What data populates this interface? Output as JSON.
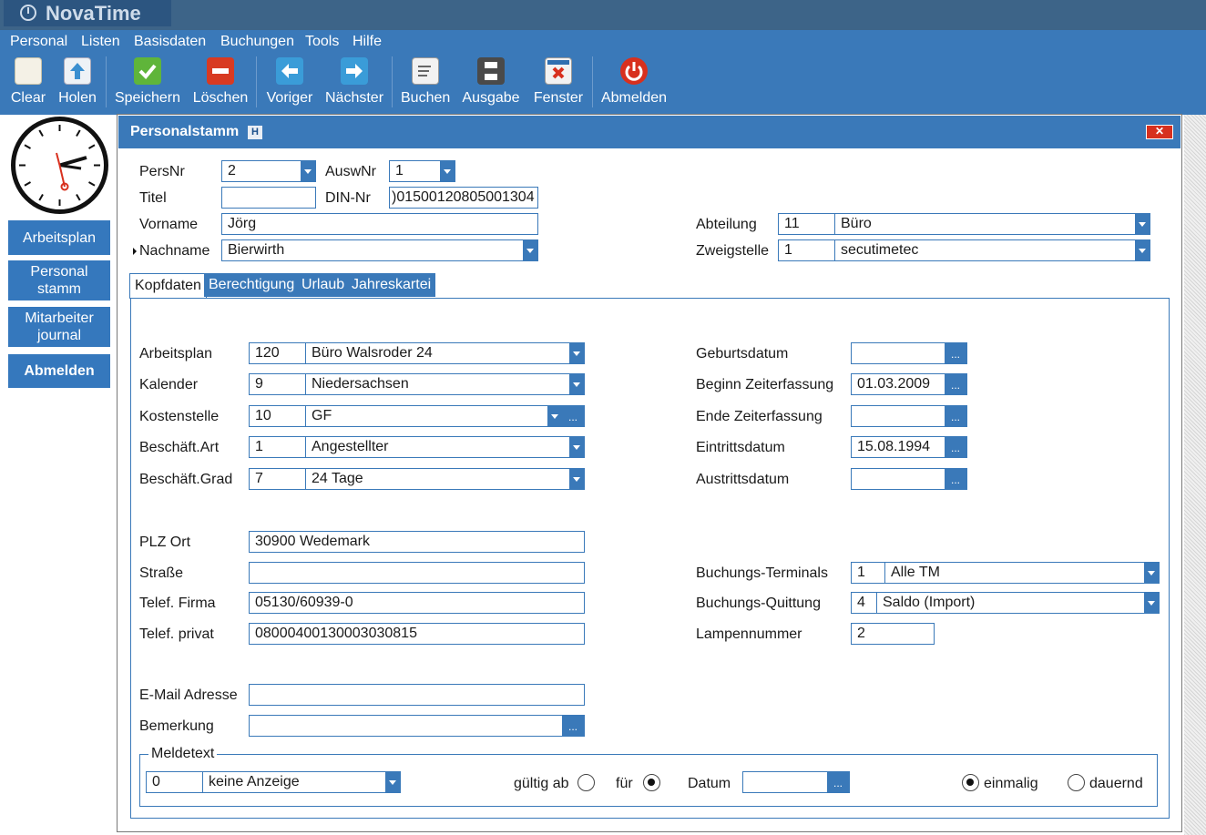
{
  "app": {
    "title": "NovaTime"
  },
  "menu": [
    "Personal",
    "Listen",
    "Basisdaten",
    "Buchungen",
    "Tools",
    "Hilfe"
  ],
  "toolbar": [
    {
      "label": "Clear",
      "icon": "document-icon"
    },
    {
      "label": "Holen",
      "icon": "upload-icon"
    },
    {
      "label": "Speichern",
      "icon": "checkmark-icon"
    },
    {
      "label": "Löschen",
      "icon": "minus-icon"
    },
    {
      "label": "Voriger",
      "icon": "arrow-left-icon"
    },
    {
      "label": "Nächster",
      "icon": "arrow-right-icon"
    },
    {
      "label": "Buchen",
      "icon": "edit-icon"
    },
    {
      "label": "Ausgabe",
      "icon": "printer-icon"
    },
    {
      "label": "Fenster",
      "icon": "close-window-icon"
    },
    {
      "label": "Abmelden",
      "icon": "power-icon"
    }
  ],
  "sidebar": {
    "arbeitsplan": "Arbeitsplan",
    "personalstamm": "Personal stamm",
    "mitarbeiterjournal": "Mitarbeiter journal",
    "abmelden": "Abmelden"
  },
  "panel": {
    "title": "Personalstamm",
    "badge": "H",
    "close": "✕"
  },
  "header": {
    "persnr_label": "PersNr",
    "persnr": "2",
    "auswnr_label": "AuswNr",
    "auswnr": "1",
    "titel_label": "Titel",
    "titel": "",
    "dinnr_label": "DIN-Nr",
    "dinnr": ")01500120805001304",
    "vorname_label": "Vorname",
    "vorname": "Jörg",
    "nachname_label": "Nachname",
    "nachname": "Bierwirth",
    "abteilung_label": "Abteilung",
    "abteilung_code": "11",
    "abteilung": "Büro",
    "zweigstelle_label": "Zweigstelle",
    "zweigstelle_code": "1",
    "zweigstelle": "secutimetec"
  },
  "tabs": [
    "Kopfdaten",
    "Berechtigung",
    "Urlaub",
    "Jahreskartei"
  ],
  "kopf": {
    "arbeitsplan_label": "Arbeitsplan",
    "arbeitsplan_code": "120",
    "arbeitsplan": "Büro Walsroder 24",
    "kalender_label": "Kalender",
    "kalender_code": "9",
    "kalender": "Niedersachsen",
    "kostenstelle_label": "Kostenstelle",
    "kostenstelle_code": "10",
    "kostenstelle": "GF",
    "art_label": "Beschäft.Art",
    "art_code": "1",
    "art": "Angestellter",
    "grad_label": "Beschäft.Grad",
    "grad_code": "7",
    "grad": "24 Tage",
    "geburt_label": "Geburtsdatum",
    "geburt": "",
    "beginn_label": "Beginn Zeiterfassung",
    "beginn": "01.03.2009",
    "ende_label": "Ende Zeiterfassung",
    "ende": "",
    "eintritt_label": "Eintrittsdatum",
    "eintritt": "15.08.1994",
    "austritt_label": "Austrittsdatum",
    "austritt": "",
    "plz_label": "PLZ Ort",
    "plz": "30900 Wedemark",
    "strasse_label": "Straße",
    "strasse": "",
    "firma_label": "Telef. Firma",
    "firma": "05130/60939-0",
    "privat_label": "Telef. privat",
    "privat": "08000400130003030815",
    "terminals_label": "Buchungs-Terminals",
    "terminals_code": "1",
    "terminals": "Alle TM",
    "quittung_label": "Buchungs-Quittung",
    "quittung_code": "4",
    "quittung": "Saldo (Import)",
    "lampe_label": "Lampennummer",
    "lampe": "2",
    "email_label": "E-Mail Adresse",
    "email": "",
    "bemerkung_label": "Bemerkung",
    "bemerkung": ""
  },
  "melde": {
    "title": "Meldetext",
    "code": "0",
    "text": "keine Anzeige",
    "gueltig_label": "gültig ab",
    "fuer_label": "für",
    "datum_label": "Datum",
    "datum": "",
    "einmalig_label": "einmalig",
    "dauernd_label": "dauernd",
    "gueltig_selected": false,
    "fuer_selected": true,
    "einmalig_selected": true,
    "dauernd_selected": false
  },
  "dots": "..."
}
